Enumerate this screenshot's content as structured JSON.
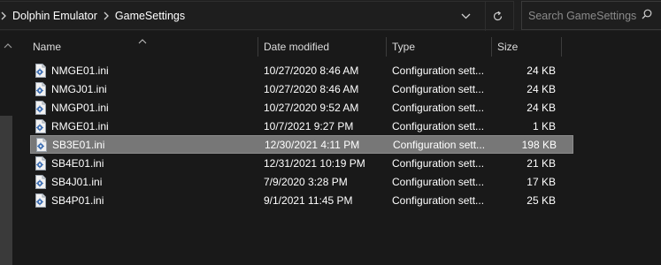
{
  "address": {
    "crumbs": [
      "Dolphin Emulator",
      "GameSettings"
    ]
  },
  "search": {
    "placeholder": "Search GameSettings"
  },
  "columns": {
    "name": "Name",
    "date": "Date modified",
    "type": "Type",
    "size": "Size"
  },
  "files": [
    {
      "name": "NMGE01.ini",
      "date": "10/27/2020 8:46 AM",
      "type": "Configuration sett...",
      "size": "24 KB"
    },
    {
      "name": "NMGJ01.ini",
      "date": "10/27/2020 8:46 AM",
      "type": "Configuration sett...",
      "size": "24 KB"
    },
    {
      "name": "NMGP01.ini",
      "date": "10/27/2020 9:52 AM",
      "type": "Configuration sett...",
      "size": "24 KB"
    },
    {
      "name": "RMGE01.ini",
      "date": "10/7/2021 9:27 PM",
      "type": "Configuration sett...",
      "size": "1 KB"
    },
    {
      "name": "SB3E01.ini",
      "date": "12/30/2021 4:11 PM",
      "type": "Configuration sett...",
      "size": "198 KB",
      "selected": true
    },
    {
      "name": "SB4E01.ini",
      "date": "12/31/2021 10:19 PM",
      "type": "Configuration sett...",
      "size": "21 KB"
    },
    {
      "name": "SB4J01.ini",
      "date": "7/9/2020 3:28 PM",
      "type": "Configuration sett...",
      "size": "17 KB"
    },
    {
      "name": "SB4P01.ini",
      "date": "9/1/2021 11:45 PM",
      "type": "Configuration sett...",
      "size": "25 KB"
    }
  ],
  "icons": {
    "file": "config-file-icon",
    "breadcrumb_separator": "chevron-right-icon",
    "history": "chevron-down-icon",
    "refresh": "refresh-icon",
    "search": "search-icon"
  },
  "colors": {
    "background": "#191919",
    "selection": "#777777",
    "text": "#ffffff"
  }
}
